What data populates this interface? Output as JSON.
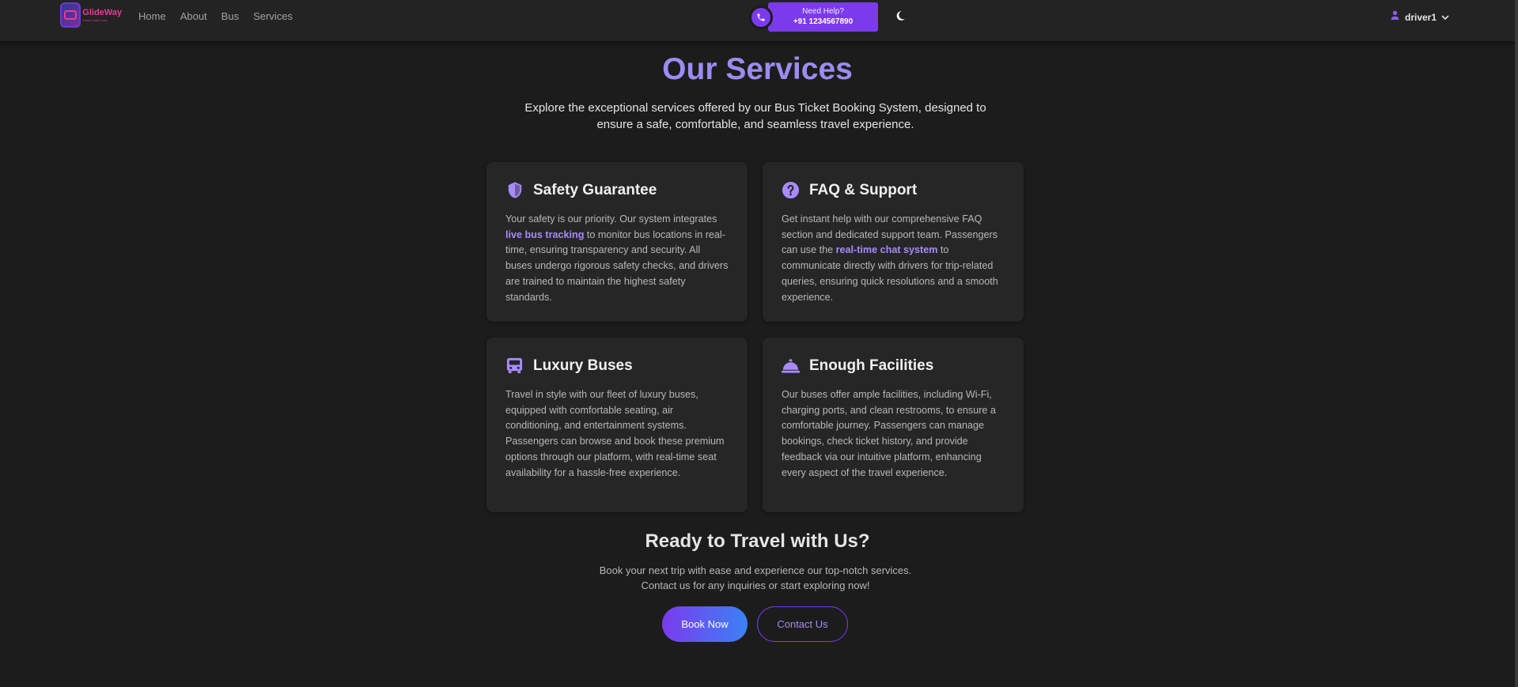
{
  "nav": {
    "logo_text": "GlideWay",
    "logo_tagline": "Travel made easy",
    "links": [
      "Home",
      "About",
      "Bus",
      "Services"
    ],
    "help_label": "Need Help?",
    "help_phone": "+91 1234567890",
    "username": "driver1"
  },
  "hero": {
    "title": "Our Services",
    "subtitle": "Explore the exceptional services offered by our Bus Ticket Booking System, designed to ensure a safe, comfortable, and seamless travel experience."
  },
  "cards": [
    {
      "icon": "shield-icon",
      "title": "Safety Guarantee",
      "text_before": "Your safety is our priority. Our system integrates ",
      "highlight": "live bus tracking",
      "text_after": " to monitor bus locations in real-time, ensuring transparency and security. All buses undergo rigorous safety checks, and drivers are trained to maintain the highest safety standards."
    },
    {
      "icon": "question-circle-icon",
      "title": "FAQ & Support",
      "text_before": "Get instant help with our comprehensive FAQ section and dedicated support team. Passengers can use the ",
      "highlight": "real-time chat system",
      "text_after": " to communicate directly with drivers for trip-related queries, ensuring quick resolutions and a smooth experience."
    },
    {
      "icon": "bus-icon",
      "title": "Luxury Buses",
      "text_before": "Travel in style with our fleet of luxury buses, equipped with comfortable seating, air conditioning, and entertainment systems. Passengers can browse and book these premium options through our platform, with real-time seat availability for a hassle-free experience.",
      "highlight": "",
      "text_after": ""
    },
    {
      "icon": "concierge-bell-icon",
      "title": "Enough Facilities",
      "text_before": "Our buses offer ample facilities, including Wi-Fi, charging ports, and clean restrooms, to ensure a comfortable journey. Passengers can manage bookings, check ticket history, and provide feedback via our intuitive platform, enhancing every aspect of the travel experience.",
      "highlight": "",
      "text_after": ""
    }
  ],
  "cta": {
    "title": "Ready to Travel with Us?",
    "line1": "Book your next trip with ease and experience our top-notch services.",
    "line2": "Contact us for any inquiries or start exploring now!",
    "book_label": "Book Now",
    "contact_label": "Contact Us"
  },
  "colors": {
    "accent": "#7c3aed",
    "title": "#9b8cf2",
    "highlight": "#a78bfa",
    "background": "#1c1c1c",
    "card": "#262626"
  }
}
